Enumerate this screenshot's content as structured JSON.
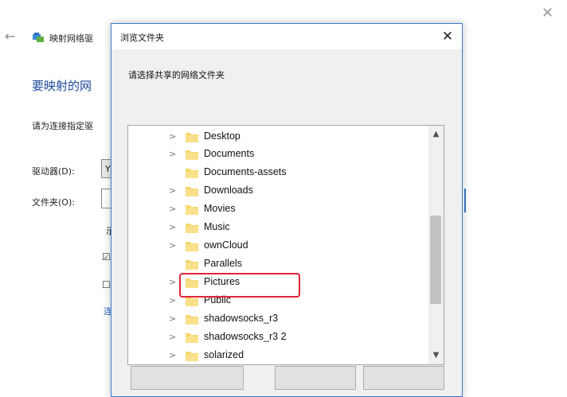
{
  "wizard": {
    "title": "映射网络驱",
    "heading": "要映射的网",
    "description": "请为连接指定驱",
    "drive_label": "驱动器(D):",
    "drive_value": "Y",
    "folder_label": "文件夹(O):",
    "example_text": "示",
    "link_text": "连"
  },
  "dialog": {
    "title": "浏览文件夹",
    "prompt": "请选择共享的网络文件夹",
    "folders": [
      {
        "label": "Desktop",
        "expandable": true
      },
      {
        "label": "Documents",
        "expandable": true
      },
      {
        "label": "Documents-assets",
        "expandable": false
      },
      {
        "label": "Downloads",
        "expandable": true
      },
      {
        "label": "Movies",
        "expandable": true
      },
      {
        "label": "Music",
        "expandable": true
      },
      {
        "label": "ownCloud",
        "expandable": true
      },
      {
        "label": "Parallels",
        "expandable": false
      },
      {
        "label": "Pictures",
        "expandable": true,
        "highlighted": true
      },
      {
        "label": "Public",
        "expandable": true
      },
      {
        "label": "shadowsocks_r3",
        "expandable": true
      },
      {
        "label": "shadowsocks_r3 2",
        "expandable": true
      },
      {
        "label": "solarized",
        "expandable": true
      }
    ]
  },
  "colors": {
    "accent": "#3a79c9",
    "heading_blue": "#1c4a9c",
    "highlight_red": "#e0243a",
    "folder_yellow": "#f6d66b"
  }
}
